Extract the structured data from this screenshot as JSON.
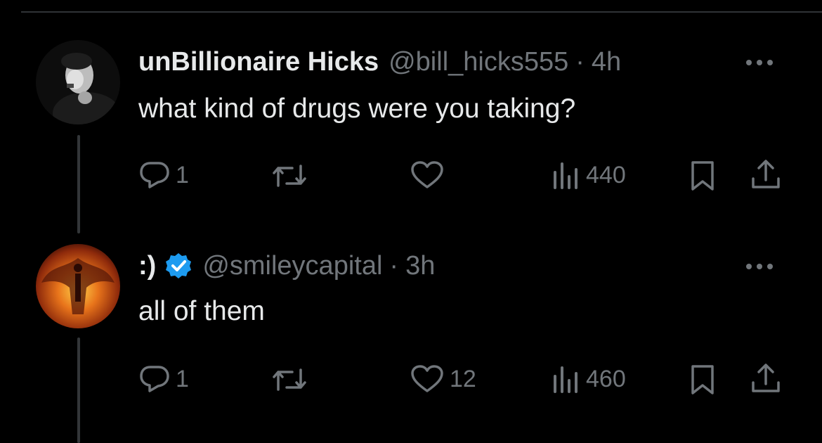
{
  "tweets": [
    {
      "name": "unBillionaire Hicks",
      "handle": "@bill_hicks555",
      "separator": "·",
      "time": "4h",
      "text": "what kind of drugs were you taking?",
      "verified": false,
      "avatar_icon": "person-portrait-bw",
      "actions": {
        "replies": "1",
        "reposts": "",
        "likes": "",
        "views": "440"
      }
    },
    {
      "name": ":)",
      "handle": "@smileycapital",
      "separator": "·",
      "time": "3h",
      "text": "all of them",
      "verified": true,
      "avatar_icon": "phoenix-fire",
      "actions": {
        "replies": "1",
        "reposts": "",
        "likes": "12",
        "views": "460"
      }
    }
  ],
  "colors": {
    "background": "#000000",
    "primary_text": "#e7e9ea",
    "secondary_text": "#71767b",
    "verified_blue": "#1d9bf0",
    "divider": "#2f3336"
  }
}
